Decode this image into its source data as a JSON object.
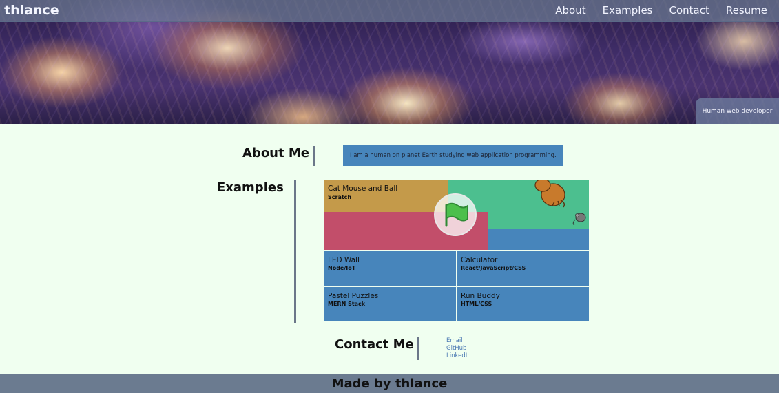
{
  "navbar": {
    "brand": "thlance",
    "links": [
      "About",
      "Examples",
      "Contact",
      "Resume"
    ]
  },
  "hero": {
    "tagline": "Human web developer"
  },
  "about": {
    "heading": "About Me",
    "text": "I am a human on planet Earth studying web application programming."
  },
  "examples": {
    "heading": "Examples",
    "featured": {
      "title": "Cat Mouse and Ball",
      "subtitle": "Scratch"
    },
    "tiles": [
      {
        "title": "LED Wall",
        "subtitle": "Node/IoT"
      },
      {
        "title": "Calculator",
        "subtitle": "React/JavaScript/CSS"
      },
      {
        "title": "Pastel Puzzles",
        "subtitle": "MERN Stack"
      },
      {
        "title": "Run Buddy",
        "subtitle": "HTML/CSS"
      }
    ]
  },
  "contact": {
    "heading": "Contact Me",
    "links": [
      "Email",
      "GitHub",
      "LinkedIn"
    ]
  },
  "footer": {
    "text": "Made by thlance"
  },
  "colors": {
    "background": "#f0fff0",
    "accent_blue": "#4785bb",
    "nav": "#6e7d96",
    "footer": "#6b7b90",
    "divider": "#6b7789",
    "scratch_gold": "#c49a4a",
    "scratch_green": "#4cbf8f",
    "scratch_red": "#c24e6a"
  },
  "icons": [
    "green-flag-icon",
    "cat-icon",
    "mouse-icon"
  ]
}
